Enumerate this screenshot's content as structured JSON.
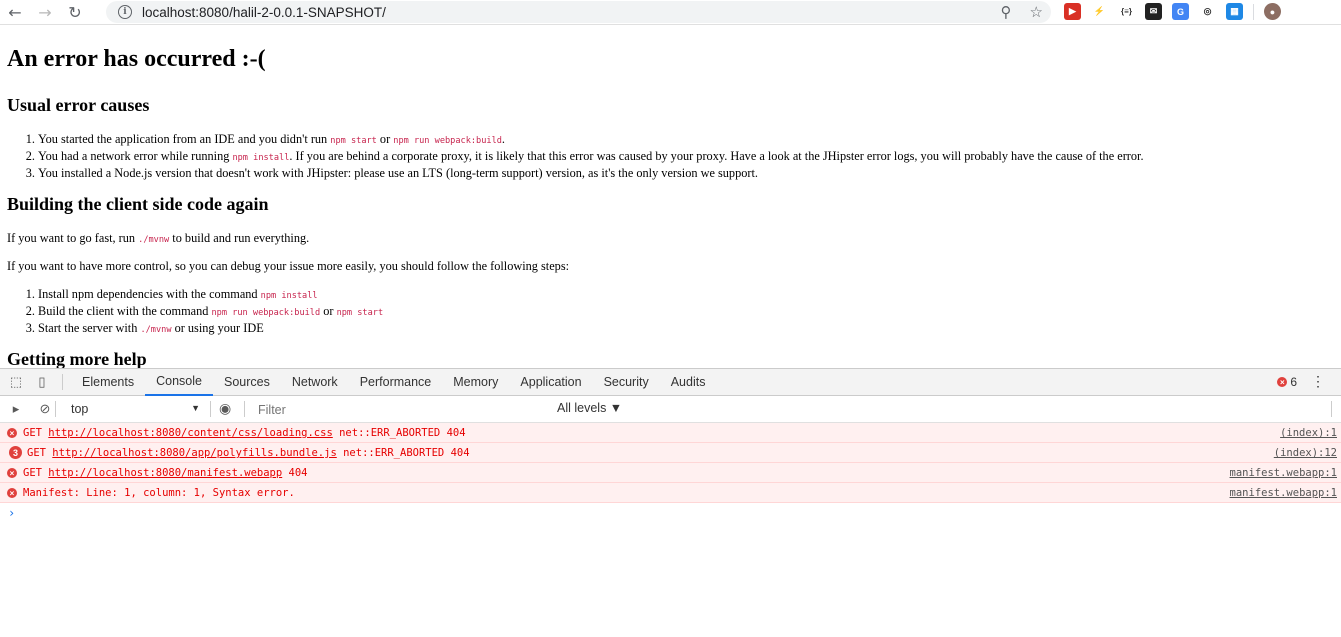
{
  "browser": {
    "url": "localhost:8080/halil-2-0.0.1-SNAPSHOT/",
    "back": "←",
    "forward": "→",
    "reload": "↻"
  },
  "page": {
    "title": "An error has occurred :-(",
    "causes_heading": "Usual error causes",
    "causes": [
      {
        "a": "You started the application from an IDE and you didn't run ",
        "c1": "npm start",
        "b": " or ",
        "c2": "npm run webpack:build",
        "d": "."
      },
      {
        "a": "You had a network error while running ",
        "c1": "npm install",
        "b": ". If you are behind a corporate proxy, it is likely that this error was caused by your proxy. Have a look at the JHipster error logs, you will probably have the cause of the error."
      },
      {
        "a": "You installed a Node.js version that doesn't work with JHipster: please use an LTS (long-term support) version, as it's the only version we support."
      }
    ],
    "building_heading": "Building the client side code again",
    "fast_a": "If you want to go fast, run ",
    "fast_code": "./mvnw",
    "fast_b": " to build and run everything.",
    "control_text": "If you want to have more control, so you can debug your issue more easily, you should follow the following steps:",
    "steps": [
      {
        "a": "Install npm dependencies with the command ",
        "c1": "npm install"
      },
      {
        "a": "Build the client with the command ",
        "c1": "npm run webpack:build",
        "b": " or ",
        "c2": "npm start"
      },
      {
        "a": "Start the server with ",
        "c1": "./mvnw",
        "b": " or using your IDE"
      }
    ],
    "help_heading": "Getting more help"
  },
  "devtools": {
    "tabs": [
      "Elements",
      "Console",
      "Sources",
      "Network",
      "Performance",
      "Memory",
      "Application",
      "Security",
      "Audits"
    ],
    "active_tab": "Console",
    "error_count": "6",
    "context": "top",
    "filter_placeholder": "Filter",
    "levels": "All levels ▼",
    "messages": [
      {
        "icon": "×",
        "pre": "GET ",
        "link": "http://localhost:8080/content/css/loading.css",
        "post": " net::ERR_ABORTED 404",
        "source": "(index):1"
      },
      {
        "icon": "3",
        "pre": "GET ",
        "link": "http://localhost:8080/app/polyfills.bundle.js",
        "post": " net::ERR_ABORTED 404",
        "source": "(index):12"
      },
      {
        "icon": "×",
        "pre": "GET ",
        "link": "http://localhost:8080/manifest.webapp",
        "post": " 404",
        "source": "manifest.webapp:1"
      },
      {
        "icon": "×",
        "pre": "Manifest: Line: 1, column: 1, Syntax error.",
        "link": "",
        "post": "",
        "source": "manifest.webapp:1"
      }
    ],
    "prompt": "›"
  },
  "colors": {
    "accent": "#1a73e8",
    "error": "#e60000",
    "error_bg": "#fff0f0"
  }
}
